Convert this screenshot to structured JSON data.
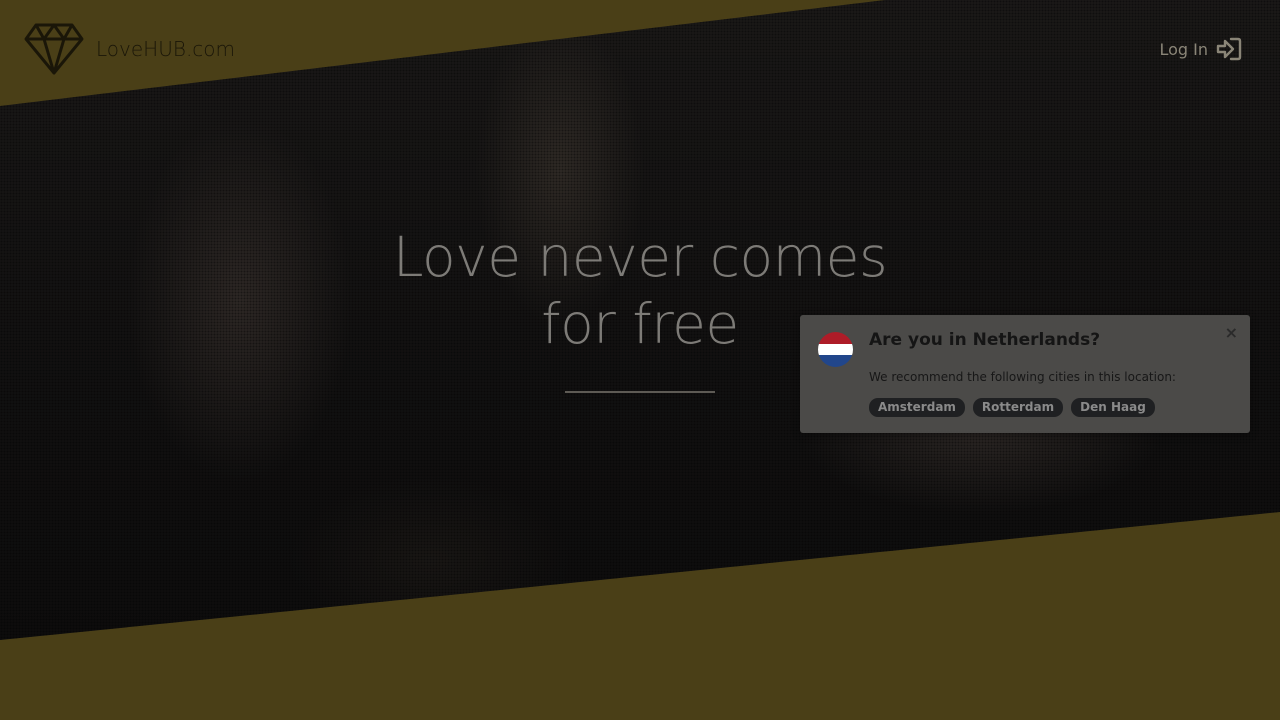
{
  "header": {
    "brand": "LoveHUB.com",
    "login_label": "Log In"
  },
  "hero": {
    "headline_line1": "Love never comes",
    "headline_line2": "for free"
  },
  "geo_popup": {
    "title": "Are you in Netherlands?",
    "subtitle": "We recommend the following cities in this location:",
    "close": "×",
    "cities": [
      "Amsterdam",
      "Rotterdam",
      "Den Haag"
    ],
    "flag_colors": [
      "#ae1c28",
      "#ffffff",
      "#21468b"
    ]
  },
  "icons": {
    "logo": "diamond-icon",
    "login": "sign-in-icon",
    "close": "close-icon",
    "flag": "netherlands-flag-icon"
  },
  "colors": {
    "accent": "#4a3f17",
    "hero_bg": "#121111",
    "headline": "#7d7b77",
    "popup_bg": "#4b4a48",
    "chip_bg": "#1f2022"
  }
}
